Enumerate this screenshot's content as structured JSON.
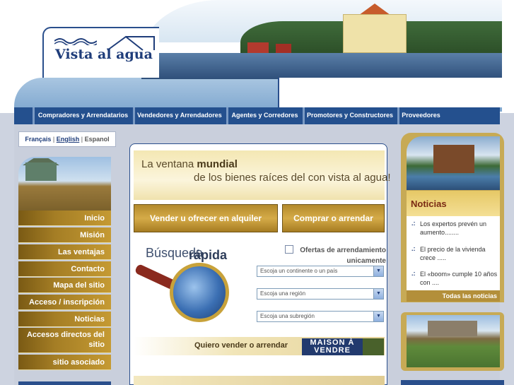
{
  "logo": {
    "text": "Vista al agua"
  },
  "nav": {
    "items": [
      "Compradores y Arrendatarios",
      "Vendedores y Arrendadores",
      "Agentes y Corredores",
      "Promotores y Constructores",
      "Proveedores"
    ]
  },
  "languages": {
    "fr": "Français",
    "sep": "|",
    "en": "English",
    "es": "Espanol"
  },
  "sidebar": {
    "items": [
      "Inicio",
      "Misión",
      "Las ventajas",
      "Contacto",
      "Mapa del sitio",
      "Acceso / inscripción",
      "Noticias",
      "Accesos directos del sitio",
      "sitio asociado"
    ]
  },
  "banner": {
    "line1_prefix": "La ventana ",
    "line1_bold": "mundial",
    "line2": "de los bienes raíces del con vista al agua!"
  },
  "buttons": {
    "sell_rent": "Vender u ofrecer en alquiler",
    "buy_rent": "Comprar o arrendar"
  },
  "quick_search": {
    "title_a": "Búsqueda",
    "title_b": "rápida",
    "checkbox_label": "Ofertas de arrendamiento unicamente",
    "selects": [
      "Escoja un continente o un país",
      "Escoja una región",
      "Escoja una subregión"
    ]
  },
  "sell_strip": {
    "label": "Quiero vender o arrendar",
    "sign": "MAISON À VENDRE"
  },
  "news": {
    "title": "Noticias",
    "items": [
      "Los expertos prevén un aumento........",
      "El precio de la vivienda crece .....",
      "El «boom» cumple 10 años con ...."
    ],
    "all_link": "Todas las noticias"
  },
  "colors": {
    "navy": "#24508e",
    "gold": "#c59a33",
    "news_title": "#7a2a14"
  }
}
